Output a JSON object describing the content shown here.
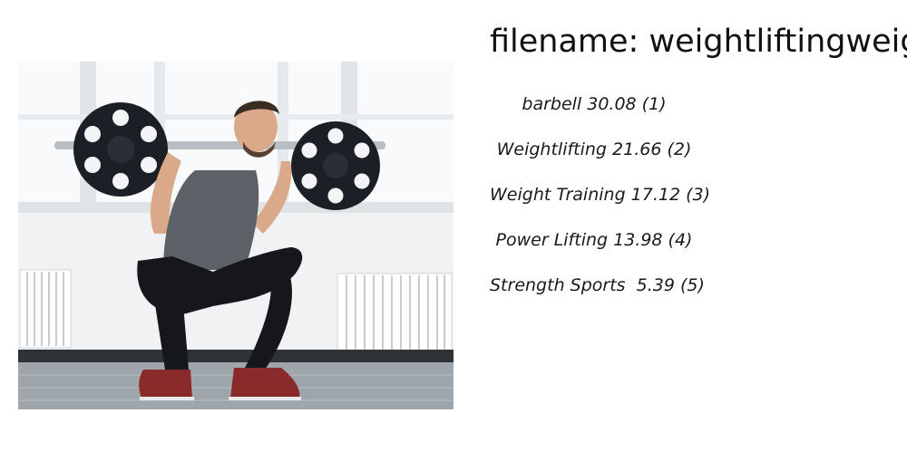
{
  "title": {
    "prefix": "filename: ",
    "value": "weightliftingweight"
  },
  "labels": [
    {
      "text": "barbell 30.08 (1)"
    },
    {
      "text": "Weightlifting 21.66 (2)"
    },
    {
      "text": "Weight Training 17.12 (3)"
    },
    {
      "text": "Power Lifting 13.98 (4)"
    },
    {
      "text": "Strength Sports  5.39 (5)"
    }
  ],
  "photo": {
    "subject": "man squatting with loaded barbell in bright gym",
    "colors": {
      "wall": "#f1f3f5",
      "window": "#fbfcfd",
      "floor": "#9aa1a8",
      "plate": "#1c1f26",
      "shirt": "#5d6268",
      "tights": "#15171b",
      "shoe": "#8b2a2a",
      "skin": "#d9a98a"
    }
  }
}
